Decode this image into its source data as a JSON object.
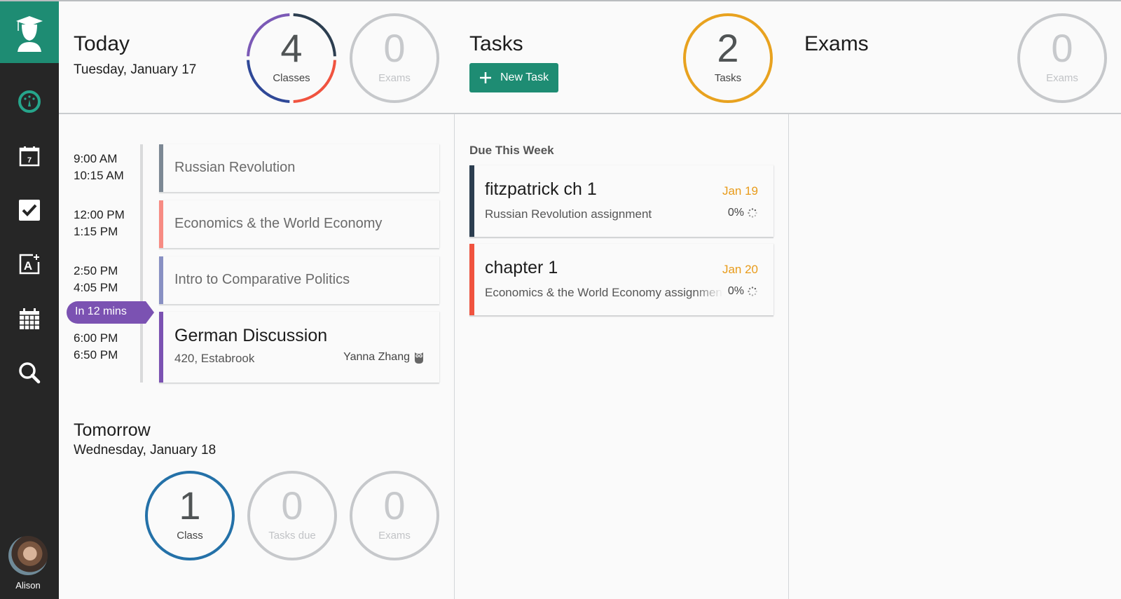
{
  "colors": {
    "brand": "#1e8c73",
    "sidebar": "#262626",
    "task_due": "#e89b1a",
    "tasks_ring": "#e8a21f",
    "muted_ring": "#c6c8cb",
    "class_ring_tomorrow": "#2471a8"
  },
  "sidebar": {
    "logo": "graduate-logo-icon",
    "items": [
      {
        "name": "dashboard",
        "icon": "dashboard-gauge-icon",
        "active": true
      },
      {
        "name": "schedule",
        "icon": "calendar-day-icon",
        "day_label": "7"
      },
      {
        "name": "tasks",
        "icon": "checkbox-icon"
      },
      {
        "name": "exams",
        "icon": "grade-a-plus-icon"
      },
      {
        "name": "calendar",
        "icon": "calendar-grid-icon"
      },
      {
        "name": "search",
        "icon": "search-icon"
      }
    ],
    "user": {
      "name": "Alison"
    }
  },
  "today": {
    "title": "Today",
    "date": "Tuesday, January 17",
    "classes": {
      "count": "4",
      "label": "Classes",
      "segments": [
        "#2c3e50",
        "#f0533f",
        "#2f4897",
        "#7b59b6"
      ]
    },
    "exams": {
      "count": "0",
      "label": "Exams"
    },
    "schedule": [
      {
        "start": "9:00 AM",
        "end": "10:15 AM",
        "name": "Russian Revolution",
        "color": "#7c8894"
      },
      {
        "start": "12:00 PM",
        "end": "1:15 PM",
        "name": "Economics & the World Economy",
        "color": "#f78b83"
      },
      {
        "start": "2:50 PM",
        "end": "4:05 PM",
        "name": "Intro to Comparative Politics",
        "color": "#8890c3"
      },
      {
        "start": "6:00 PM",
        "end": "6:50 PM",
        "name": "German Discussion",
        "color": "#7b52b2",
        "location": "420, Estabrook",
        "teacher": "Yanna Zhang"
      }
    ],
    "next_badge": "In 12 mins",
    "next_badge_color": "#7b52b2"
  },
  "tomorrow": {
    "title": "Tomorrow",
    "date": "Wednesday, January 18",
    "classes": {
      "count": "1",
      "label": "Class"
    },
    "tasks": {
      "count": "0",
      "label": "Tasks due"
    },
    "exams": {
      "count": "0",
      "label": "Exams"
    }
  },
  "tasks": {
    "title": "Tasks",
    "new_task_label": "New Task",
    "count": {
      "count": "2",
      "label": "Tasks"
    },
    "section": "Due This Week",
    "items": [
      {
        "title": "fitzpatrick ch 1",
        "course": "Russian Revolution assignment",
        "due": "Jan 19",
        "progress": "0%",
        "color": "#2c3e50"
      },
      {
        "title": "chapter 1",
        "course": "Economics & the World Economy assignment",
        "due": "Jan 20",
        "progress": "0%",
        "color": "#f0533f"
      }
    ]
  },
  "exams": {
    "title": "Exams",
    "count": {
      "count": "0",
      "label": "Exams"
    }
  }
}
